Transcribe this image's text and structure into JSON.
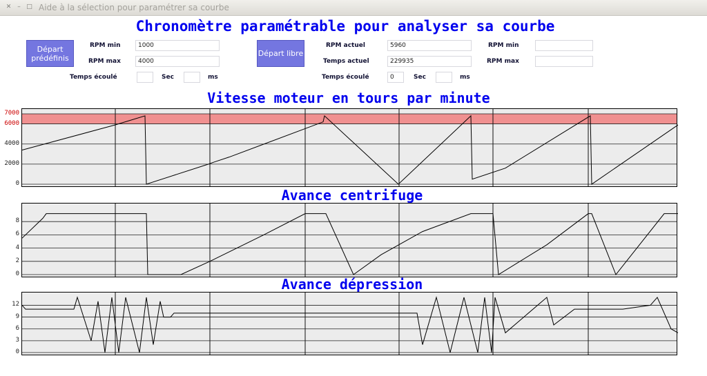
{
  "window": {
    "title": "Aide à la sélection pour paramétrer sa courbe"
  },
  "header": {
    "title": "Chronomètre paramétrable pour analyser sa courbe"
  },
  "controls": {
    "preset": {
      "button": "Départ prédéfinis",
      "rpm_min_label": "RPM min",
      "rpm_min": "1000",
      "rpm_max_label": "RPM max",
      "rpm_max": "4000"
    },
    "free": {
      "button": "Départ libre",
      "rpm_actuel_label": "RPM actuel",
      "rpm_actuel": "5960",
      "temps_actuel_label": "Temps actuel",
      "temps_actuel": "229935",
      "rpm_min_label": "RPM min",
      "rpm_min": "",
      "rpm_max_label": "RPM max",
      "rpm_max": ""
    },
    "elapsed_left": {
      "label": "Temps écoulé",
      "sec": "",
      "sec_label": "Sec",
      "ms": "",
      "ms_label": "ms"
    },
    "elapsed_right": {
      "label": "Temps écoulé",
      "sec": "0",
      "sec_label": "Sec",
      "ms": "",
      "ms_label": "ms"
    }
  },
  "colors": {
    "title": "#0000ee",
    "button": "#7476e0",
    "panel_bg": "#ececec",
    "redline_band": "#f09090",
    "redline_text": "#cc0000"
  },
  "chart_data": [
    {
      "type": "line",
      "title": "Vitesse moteur en tours par minute",
      "ylim": [
        0,
        7000
      ],
      "yticks": [
        "0",
        "2000",
        "4000",
        "6000",
        "7000"
      ],
      "band": {
        "from": 6000,
        "to": 7000,
        "color": "#f09090"
      },
      "vlines_ms": [
        0,
        135,
        272,
        410,
        546,
        682,
        820
      ],
      "series": [
        {
          "x": [
            0,
            135,
            178,
            180,
            270,
            278,
            300,
            436,
            438,
            545,
            650,
            652,
            700,
            823,
            825,
            950
          ],
          "values": [
            3400,
            5900,
            6800,
            0,
            2000,
            2200,
            2700,
            6200,
            6800,
            0,
            6800,
            500,
            1600,
            6800,
            0,
            5900
          ]
        }
      ]
    },
    {
      "type": "line",
      "title": "Avance centrifuge",
      "ylim": [
        0,
        10
      ],
      "yticks": [
        "0",
        "2",
        "4",
        "6",
        "8"
      ],
      "series": [
        {
          "x": [
            0,
            30,
            35,
            40,
            180,
            182,
            230,
            272,
            350,
            410,
            440,
            480,
            520,
            580,
            650,
            682,
            690,
            760,
            820,
            825,
            860,
            930,
            950
          ],
          "values": [
            5.5,
            8.5,
            9.2,
            9.2,
            9.2,
            0,
            0,
            2,
            6,
            9.2,
            9.2,
            0,
            3,
            6.5,
            9.2,
            9.2,
            0,
            4.5,
            9.2,
            9.2,
            0,
            9.2,
            9.2
          ]
        }
      ]
    },
    {
      "type": "line",
      "title": "Avance dépression",
      "ylim": [
        0,
        14
      ],
      "yticks": [
        "0",
        "3",
        "6",
        "9",
        "12"
      ],
      "series": [
        {
          "x": [
            0,
            5,
            60,
            75,
            80,
            100,
            110,
            120,
            130,
            140,
            150,
            170,
            180,
            190,
            200,
            205,
            215,
            220,
            230,
            572,
            580,
            600,
            620,
            640,
            660,
            670,
            680,
            685,
            700,
            760,
            770,
            800,
            830,
            870,
            910,
            920,
            940,
            950
          ],
          "values": [
            12,
            11,
            11,
            11,
            14,
            3,
            13,
            0,
            14,
            0,
            14,
            0,
            14,
            2,
            13,
            9,
            9,
            10,
            10,
            10,
            2,
            14,
            0,
            14,
            0,
            14,
            0,
            14,
            5,
            14,
            7,
            11,
            11,
            11,
            12,
            14,
            6,
            5
          ]
        }
      ]
    }
  ]
}
